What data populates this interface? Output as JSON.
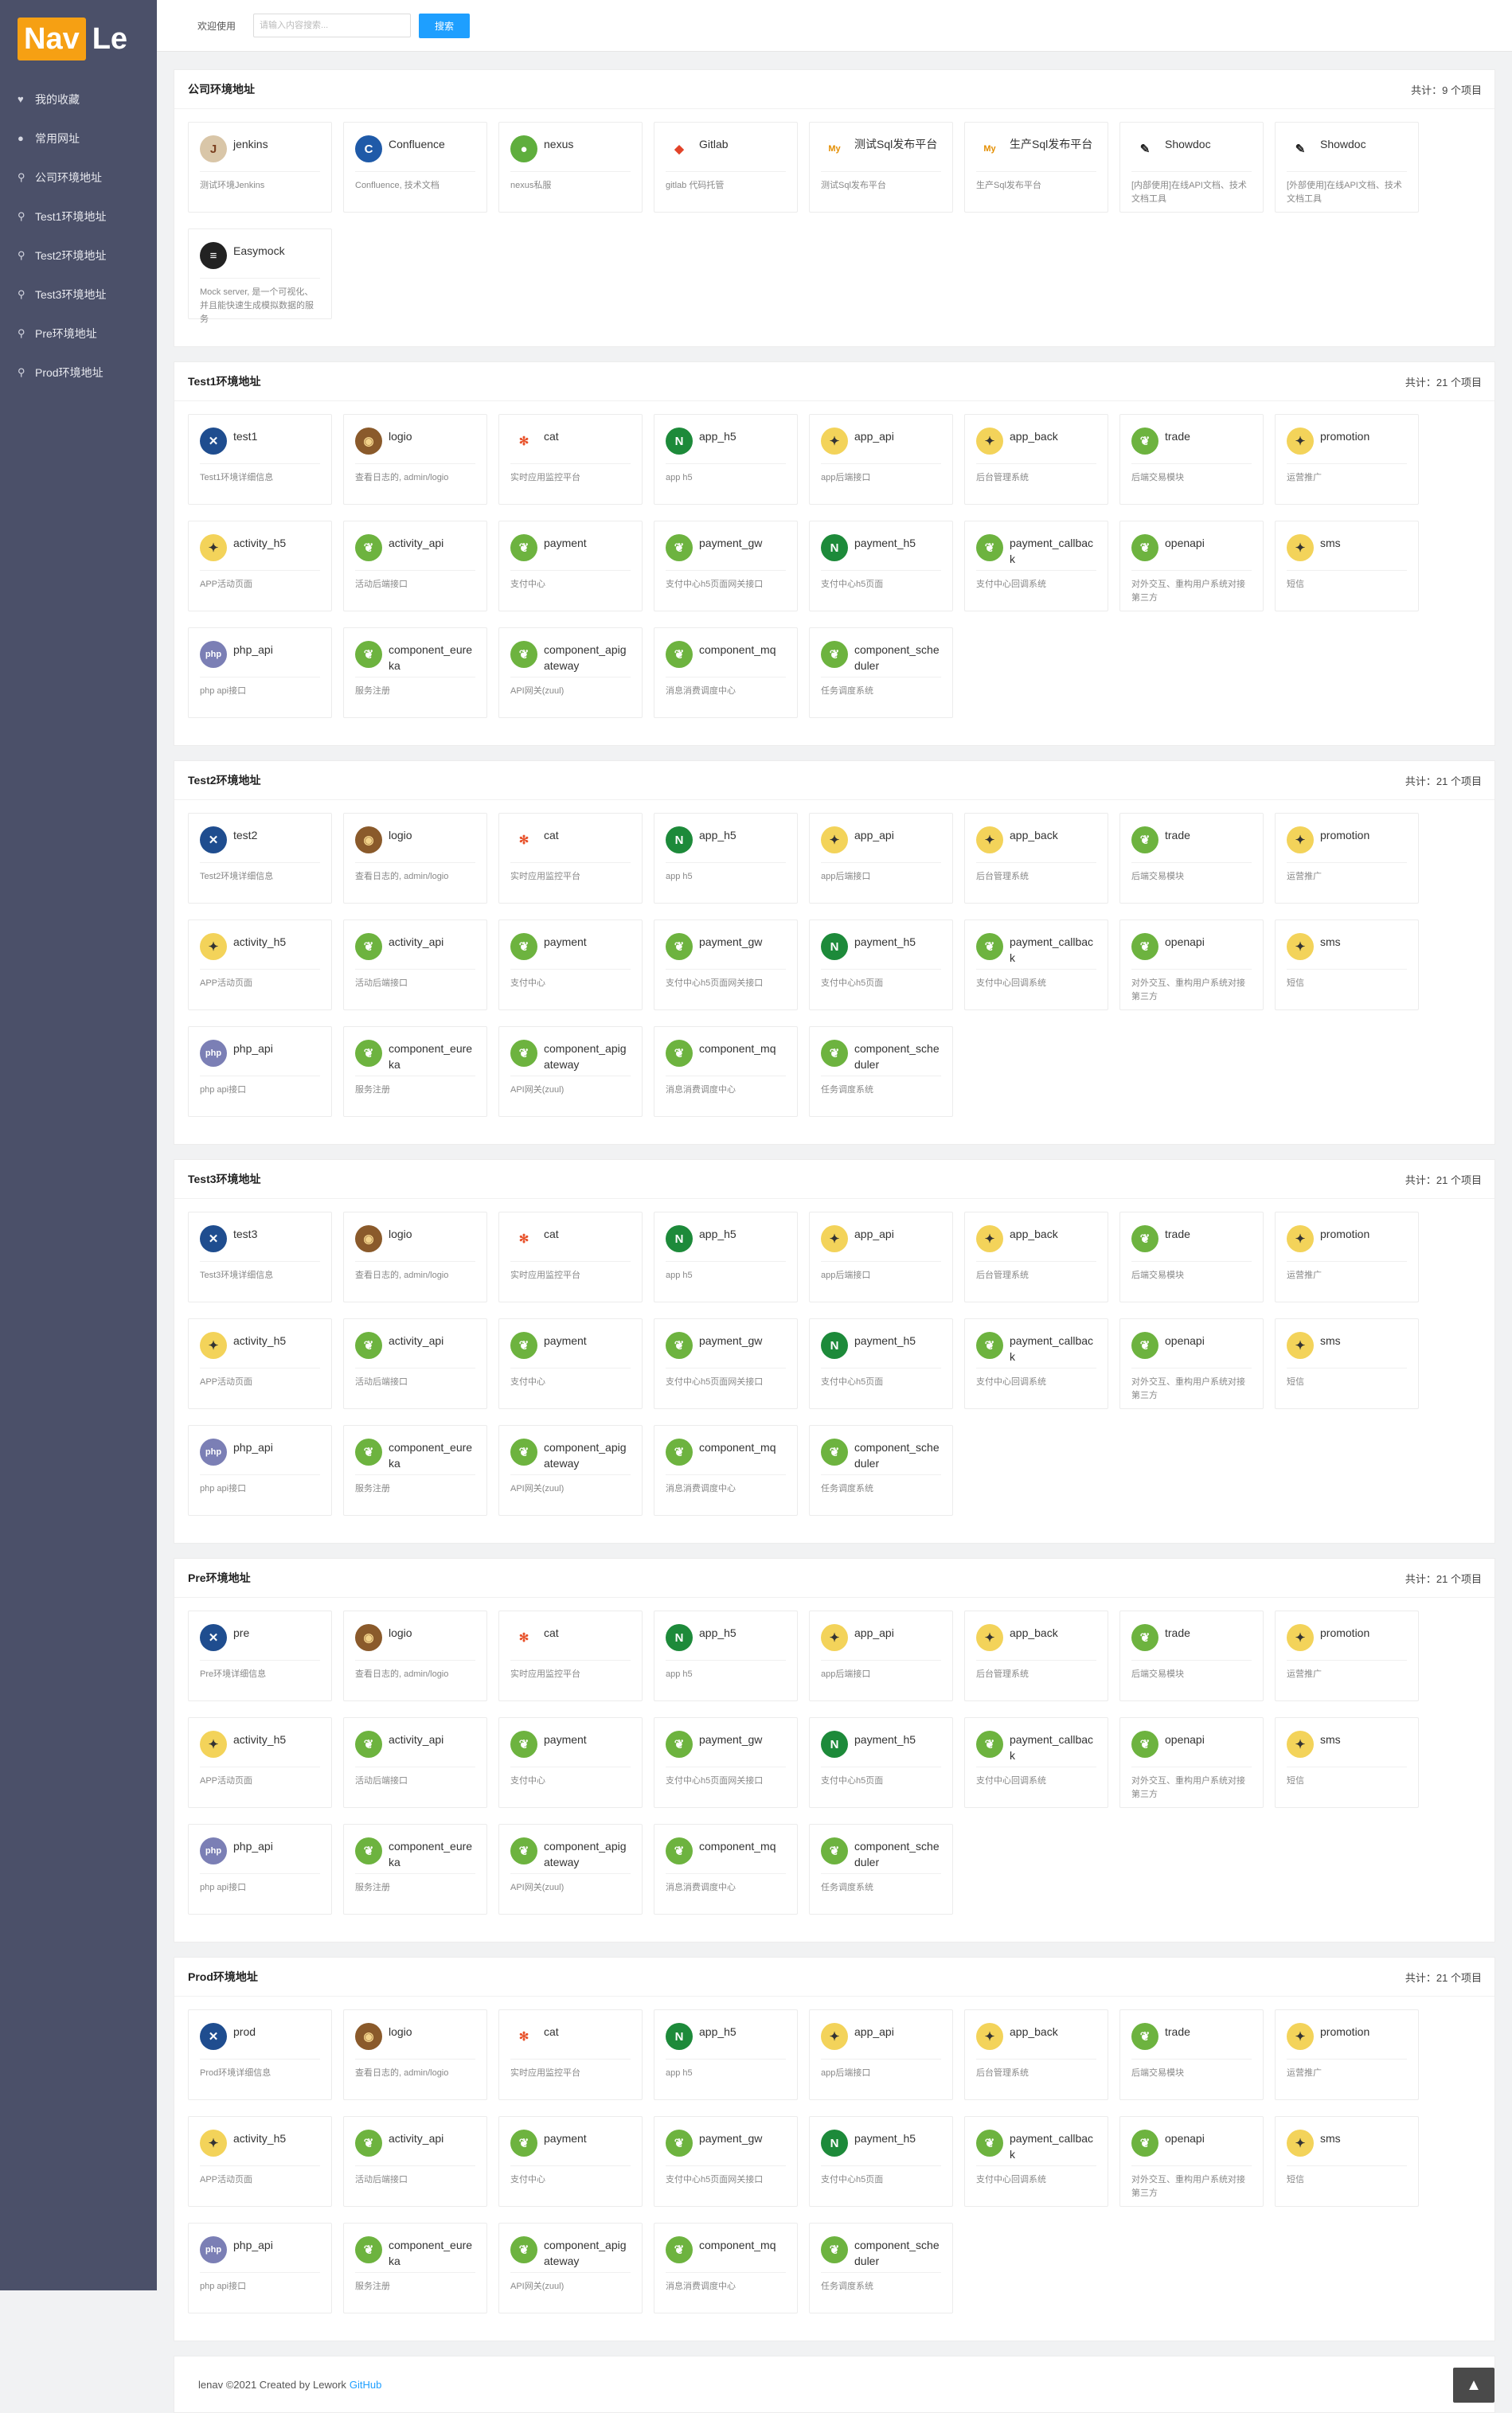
{
  "brand": {
    "logo_nav": "Nav",
    "logo_le": "Le"
  },
  "header": {
    "welcome": "欢迎使用",
    "search_placeholder": "请输入内容搜索...",
    "search_button": "搜索"
  },
  "sidebar": {
    "items": [
      {
        "label": "我的收藏",
        "icon": "heart-icon"
      },
      {
        "label": "常用网址",
        "icon": "globe-icon"
      },
      {
        "label": "公司环境地址",
        "icon": "search-icon"
      },
      {
        "label": "Test1环境地址",
        "icon": "search-icon"
      },
      {
        "label": "Test2环境地址",
        "icon": "search-icon"
      },
      {
        "label": "Test3环境地址",
        "icon": "search-icon"
      },
      {
        "label": "Pre环境地址",
        "icon": "search-icon"
      },
      {
        "label": "Prod环境地址",
        "icon": "search-icon"
      }
    ]
  },
  "colors": {
    "sidebar_bg": "#4b5069",
    "accent": "#1e9fff",
    "logo_orange": "#f6a013"
  },
  "sections": [
    {
      "title": "公司环境地址",
      "count": "共计：9 个项目",
      "cards": [
        {
          "name": "jenkins",
          "desc": "测试环境Jenkins",
          "icon": "jenkins"
        },
        {
          "name": "Confluence",
          "desc": "Confluence, 技术文档",
          "icon": "confluence"
        },
        {
          "name": "nexus",
          "desc": "nexus私服",
          "icon": "nexus"
        },
        {
          "name": "Gitlab",
          "desc": "gitlab 代码托管",
          "icon": "gitlab"
        },
        {
          "name": "测试Sql发布平台",
          "desc": "测试Sql发布平台",
          "icon": "mysql"
        },
        {
          "name": "生产Sql发布平台",
          "desc": "生产Sql发布平台",
          "icon": "mysql"
        },
        {
          "name": "Showdoc",
          "desc": "[内部使用]在线API文档、技术文档工具",
          "icon": "showdoc"
        },
        {
          "name": "Showdoc",
          "desc": "[外部使用]在线API文档、技术文档工具",
          "icon": "showdoc"
        },
        {
          "name": "Easymock",
          "desc": "Mock server, 是一个可视化、并且能快速生成模拟数据的服务",
          "icon": "easymock"
        }
      ]
    },
    {
      "title": "Test1环境地址",
      "count": "共计：21 个项目",
      "cards": [
        {
          "name": "test1",
          "desc": "Test1环境详细信息",
          "icon": "tools"
        },
        {
          "name": "logio",
          "desc": "查看日志的, admin/logio",
          "icon": "owl"
        },
        {
          "name": "cat",
          "desc": "实时应用监控平台",
          "icon": "cat"
        },
        {
          "name": "app_h5",
          "desc": "app h5",
          "icon": "nginx"
        },
        {
          "name": "app_api",
          "desc": "app后端接口",
          "icon": "tomcat"
        },
        {
          "name": "app_back",
          "desc": "后台管理系统",
          "icon": "tomcat"
        },
        {
          "name": "trade",
          "desc": "后端交易模块",
          "icon": "spring"
        },
        {
          "name": "promotion",
          "desc": "运营推广",
          "icon": "tomcat"
        },
        {
          "name": "activity_h5",
          "desc": "APP活动页面",
          "icon": "tomcat"
        },
        {
          "name": "activity_api",
          "desc": "活动后端接口",
          "icon": "spring"
        },
        {
          "name": "payment",
          "desc": "支付中心",
          "icon": "spring"
        },
        {
          "name": "payment_gw",
          "desc": "支付中心h5页面网关接口",
          "icon": "spring"
        },
        {
          "name": "payment_h5",
          "desc": "支付中心h5页面",
          "icon": "nginx"
        },
        {
          "name": "payment_callback",
          "desc": "支付中心回调系统",
          "icon": "spring"
        },
        {
          "name": "openapi",
          "desc": "对外交互、重构用户系统对接第三方",
          "icon": "spring"
        },
        {
          "name": "sms",
          "desc": "短信",
          "icon": "tomcat"
        },
        {
          "name": "php_api",
          "desc": "php api接口",
          "icon": "php"
        },
        {
          "name": "component_eureka",
          "desc": "服务注册",
          "icon": "spring"
        },
        {
          "name": "component_apigateway",
          "desc": "API网关(zuul)",
          "icon": "spring"
        },
        {
          "name": "component_mq",
          "desc": "消息消费调度中心",
          "icon": "spring"
        },
        {
          "name": "component_scheduler",
          "desc": "任务调度系统",
          "icon": "spring"
        }
      ]
    },
    {
      "title": "Test2环境地址",
      "count": "共计：21 个项目",
      "cards": [
        {
          "name": "test2",
          "desc": "Test2环境详细信息",
          "icon": "tools"
        },
        {
          "name": "logio",
          "desc": "查看日志的, admin/logio",
          "icon": "owl"
        },
        {
          "name": "cat",
          "desc": "实时应用监控平台",
          "icon": "cat"
        },
        {
          "name": "app_h5",
          "desc": "app h5",
          "icon": "nginx"
        },
        {
          "name": "app_api",
          "desc": "app后端接口",
          "icon": "tomcat"
        },
        {
          "name": "app_back",
          "desc": "后台管理系统",
          "icon": "tomcat"
        },
        {
          "name": "trade",
          "desc": "后端交易模块",
          "icon": "spring"
        },
        {
          "name": "promotion",
          "desc": "运营推广",
          "icon": "tomcat"
        },
        {
          "name": "activity_h5",
          "desc": "APP活动页面",
          "icon": "tomcat"
        },
        {
          "name": "activity_api",
          "desc": "活动后端接口",
          "icon": "spring"
        },
        {
          "name": "payment",
          "desc": "支付中心",
          "icon": "spring"
        },
        {
          "name": "payment_gw",
          "desc": "支付中心h5页面网关接口",
          "icon": "spring"
        },
        {
          "name": "payment_h5",
          "desc": "支付中心h5页面",
          "icon": "nginx"
        },
        {
          "name": "payment_callback",
          "desc": "支付中心回调系统",
          "icon": "spring"
        },
        {
          "name": "openapi",
          "desc": "对外交互、重构用户系统对接第三方",
          "icon": "spring"
        },
        {
          "name": "sms",
          "desc": "短信",
          "icon": "tomcat"
        },
        {
          "name": "php_api",
          "desc": "php api接口",
          "icon": "php"
        },
        {
          "name": "component_eureka",
          "desc": "服务注册",
          "icon": "spring"
        },
        {
          "name": "component_apigateway",
          "desc": "API网关(zuul)",
          "icon": "spring"
        },
        {
          "name": "component_mq",
          "desc": "消息消费调度中心",
          "icon": "spring"
        },
        {
          "name": "component_scheduler",
          "desc": "任务调度系统",
          "icon": "spring"
        }
      ]
    },
    {
      "title": "Test3环境地址",
      "count": "共计：21 个项目",
      "cards": [
        {
          "name": "test3",
          "desc": "Test3环境详细信息",
          "icon": "tools"
        },
        {
          "name": "logio",
          "desc": "查看日志的, admin/logio",
          "icon": "owl"
        },
        {
          "name": "cat",
          "desc": "实时应用监控平台",
          "icon": "cat"
        },
        {
          "name": "app_h5",
          "desc": "app h5",
          "icon": "nginx"
        },
        {
          "name": "app_api",
          "desc": "app后端接口",
          "icon": "tomcat"
        },
        {
          "name": "app_back",
          "desc": "后台管理系统",
          "icon": "tomcat"
        },
        {
          "name": "trade",
          "desc": "后端交易模块",
          "icon": "spring"
        },
        {
          "name": "promotion",
          "desc": "运营推广",
          "icon": "tomcat"
        },
        {
          "name": "activity_h5",
          "desc": "APP活动页面",
          "icon": "tomcat"
        },
        {
          "name": "activity_api",
          "desc": "活动后端接口",
          "icon": "spring"
        },
        {
          "name": "payment",
          "desc": "支付中心",
          "icon": "spring"
        },
        {
          "name": "payment_gw",
          "desc": "支付中心h5页面网关接口",
          "icon": "spring"
        },
        {
          "name": "payment_h5",
          "desc": "支付中心h5页面",
          "icon": "nginx"
        },
        {
          "name": "payment_callback",
          "desc": "支付中心回调系统",
          "icon": "spring"
        },
        {
          "name": "openapi",
          "desc": "对外交互、重构用户系统对接第三方",
          "icon": "spring"
        },
        {
          "name": "sms",
          "desc": "短信",
          "icon": "tomcat"
        },
        {
          "name": "php_api",
          "desc": "php api接口",
          "icon": "php"
        },
        {
          "name": "component_eureka",
          "desc": "服务注册",
          "icon": "spring"
        },
        {
          "name": "component_apigateway",
          "desc": "API网关(zuul)",
          "icon": "spring"
        },
        {
          "name": "component_mq",
          "desc": "消息消费调度中心",
          "icon": "spring"
        },
        {
          "name": "component_scheduler",
          "desc": "任务调度系统",
          "icon": "spring"
        }
      ]
    },
    {
      "title": "Pre环境地址",
      "count": "共计：21 个项目",
      "cards": [
        {
          "name": "pre",
          "desc": "Pre环境详细信息",
          "icon": "tools"
        },
        {
          "name": "logio",
          "desc": "查看日志的, admin/logio",
          "icon": "owl"
        },
        {
          "name": "cat",
          "desc": "实时应用监控平台",
          "icon": "cat"
        },
        {
          "name": "app_h5",
          "desc": "app h5",
          "icon": "nginx"
        },
        {
          "name": "app_api",
          "desc": "app后端接口",
          "icon": "tomcat"
        },
        {
          "name": "app_back",
          "desc": "后台管理系统",
          "icon": "tomcat"
        },
        {
          "name": "trade",
          "desc": "后端交易模块",
          "icon": "spring"
        },
        {
          "name": "promotion",
          "desc": "运营推广",
          "icon": "tomcat"
        },
        {
          "name": "activity_h5",
          "desc": "APP活动页面",
          "icon": "tomcat"
        },
        {
          "name": "activity_api",
          "desc": "活动后端接口",
          "icon": "spring"
        },
        {
          "name": "payment",
          "desc": "支付中心",
          "icon": "spring"
        },
        {
          "name": "payment_gw",
          "desc": "支付中心h5页面网关接口",
          "icon": "spring"
        },
        {
          "name": "payment_h5",
          "desc": "支付中心h5页面",
          "icon": "nginx"
        },
        {
          "name": "payment_callback",
          "desc": "支付中心回调系统",
          "icon": "spring"
        },
        {
          "name": "openapi",
          "desc": "对外交互、重构用户系统对接第三方",
          "icon": "spring"
        },
        {
          "name": "sms",
          "desc": "短信",
          "icon": "tomcat"
        },
        {
          "name": "php_api",
          "desc": "php api接口",
          "icon": "php"
        },
        {
          "name": "component_eureka",
          "desc": "服务注册",
          "icon": "spring"
        },
        {
          "name": "component_apigateway",
          "desc": "API网关(zuul)",
          "icon": "spring"
        },
        {
          "name": "component_mq",
          "desc": "消息消费调度中心",
          "icon": "spring"
        },
        {
          "name": "component_scheduler",
          "desc": "任务调度系统",
          "icon": "spring"
        }
      ]
    },
    {
      "title": "Prod环境地址",
      "count": "共计：21 个项目",
      "cards": [
        {
          "name": "prod",
          "desc": "Prod环境详细信息",
          "icon": "tools"
        },
        {
          "name": "logio",
          "desc": "查看日志的, admin/logio",
          "icon": "owl"
        },
        {
          "name": "cat",
          "desc": "实时应用监控平台",
          "icon": "cat"
        },
        {
          "name": "app_h5",
          "desc": "app h5",
          "icon": "nginx"
        },
        {
          "name": "app_api",
          "desc": "app后端接口",
          "icon": "tomcat"
        },
        {
          "name": "app_back",
          "desc": "后台管理系统",
          "icon": "tomcat"
        },
        {
          "name": "trade",
          "desc": "后端交易模块",
          "icon": "spring"
        },
        {
          "name": "promotion",
          "desc": "运营推广",
          "icon": "tomcat"
        },
        {
          "name": "activity_h5",
          "desc": "APP活动页面",
          "icon": "tomcat"
        },
        {
          "name": "activity_api",
          "desc": "活动后端接口",
          "icon": "spring"
        },
        {
          "name": "payment",
          "desc": "支付中心",
          "icon": "spring"
        },
        {
          "name": "payment_gw",
          "desc": "支付中心h5页面网关接口",
          "icon": "spring"
        },
        {
          "name": "payment_h5",
          "desc": "支付中心h5页面",
          "icon": "nginx"
        },
        {
          "name": "payment_callback",
          "desc": "支付中心回调系统",
          "icon": "spring"
        },
        {
          "name": "openapi",
          "desc": "对外交互、重构用户系统对接第三方",
          "icon": "spring"
        },
        {
          "name": "sms",
          "desc": "短信",
          "icon": "tomcat"
        },
        {
          "name": "php_api",
          "desc": "php api接口",
          "icon": "php"
        },
        {
          "name": "component_eureka",
          "desc": "服务注册",
          "icon": "spring"
        },
        {
          "name": "component_apigateway",
          "desc": "API网关(zuul)",
          "icon": "spring"
        },
        {
          "name": "component_mq",
          "desc": "消息消费调度中心",
          "icon": "spring"
        },
        {
          "name": "component_scheduler",
          "desc": "任务调度系统",
          "icon": "spring"
        }
      ]
    }
  ],
  "footer": {
    "text": "lenav ©2021 Created by Lework",
    "link": "GitHub",
    "back_to_top": "▲"
  }
}
